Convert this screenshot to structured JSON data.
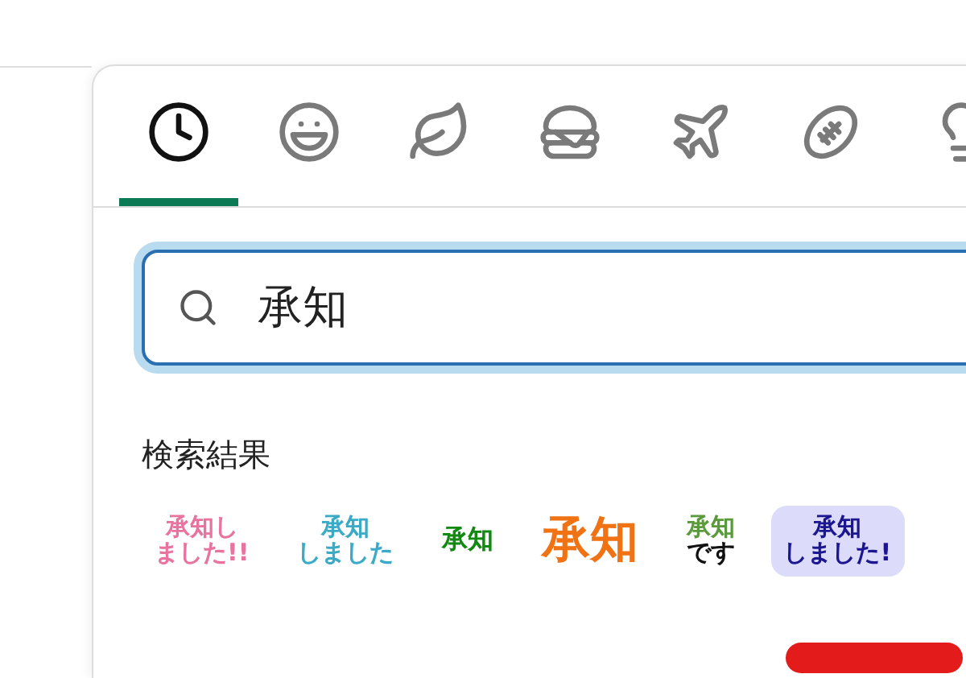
{
  "tabs": [
    {
      "kind": "recent",
      "selected": true
    },
    {
      "kind": "people",
      "selected": false
    },
    {
      "kind": "nature",
      "selected": false
    },
    {
      "kind": "food",
      "selected": false
    },
    {
      "kind": "travel",
      "selected": false
    },
    {
      "kind": "activity",
      "selected": false
    },
    {
      "kind": "objects",
      "selected": false
    }
  ],
  "search": {
    "value": "承知"
  },
  "results": {
    "heading": "検索結果",
    "items": [
      {
        "selected": false,
        "kind": "normal",
        "lines": [
          {
            "text": "承知し",
            "color": "#e8739f"
          },
          {
            "text": "ました!!",
            "color": "#e8739f"
          }
        ]
      },
      {
        "selected": false,
        "kind": "normal",
        "lines": [
          {
            "text": "承知",
            "color": "#3aaac6"
          },
          {
            "text": "しました",
            "color": "#3aaac6"
          }
        ]
      },
      {
        "selected": false,
        "kind": "compact",
        "lines": [
          {
            "text": "承知",
            "color": "#128a12"
          }
        ]
      },
      {
        "selected": false,
        "kind": "big",
        "lines": [
          {
            "text": "承知",
            "color": "#f07212"
          }
        ]
      },
      {
        "selected": false,
        "kind": "normal",
        "lines": [
          {
            "text": "承知",
            "color": "#5a9a3c"
          },
          {
            "text": "です",
            "color": "#111111"
          }
        ]
      },
      {
        "selected": true,
        "kind": "normal",
        "lines": [
          {
            "text": "承知",
            "color": "#1c1690"
          },
          {
            "text": "しました!",
            "color": "#1c1690"
          }
        ]
      }
    ]
  }
}
